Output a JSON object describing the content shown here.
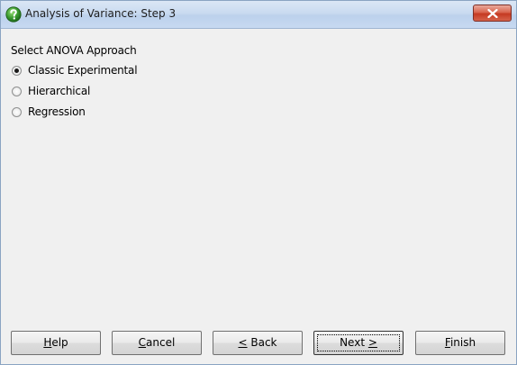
{
  "window": {
    "title": "Analysis of Variance: Step 3"
  },
  "group": {
    "label": "Select ANOVA Approach",
    "options": [
      {
        "label": "Classic Experimental",
        "checked": true
      },
      {
        "label": "Hierarchical",
        "checked": false
      },
      {
        "label": "Regression",
        "checked": false
      }
    ]
  },
  "buttons": {
    "help": {
      "mnemonic": "H",
      "rest": "elp"
    },
    "cancel": {
      "mnemonic": "C",
      "rest": "ancel"
    },
    "back": {
      "mnemonic": "<",
      "rest": " Back"
    },
    "next": {
      "pre": "Next ",
      "mnemonic": ">"
    },
    "finish": {
      "mnemonic": "F",
      "rest": "inish"
    }
  },
  "icons": {
    "app": "help-question-icon",
    "close": "close-icon"
  },
  "colors": {
    "close_button": "#c53a22",
    "app_icon": "#3a9b2e"
  }
}
